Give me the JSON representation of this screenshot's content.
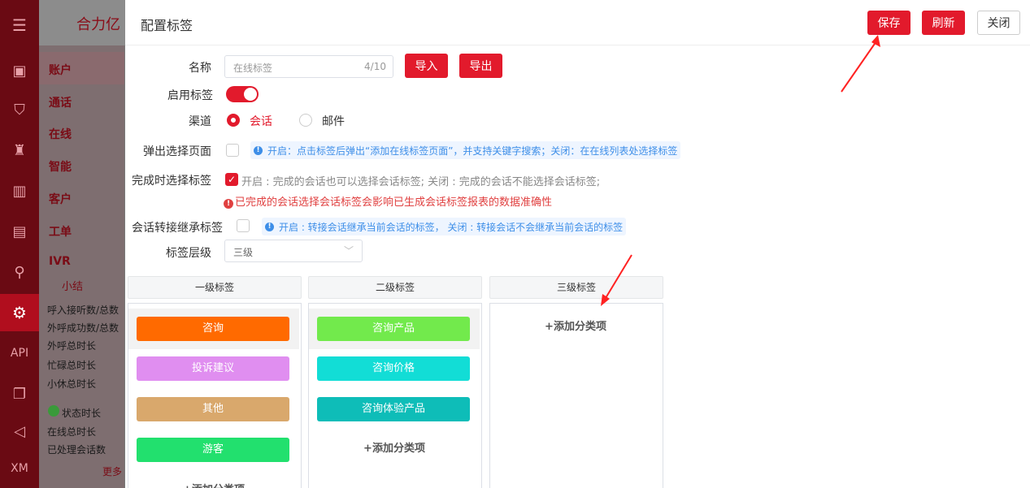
{
  "rail": {
    "items": [
      {
        "icon": "menu-icon",
        "glyph": "☰"
      },
      {
        "icon": "monitor-icon",
        "glyph": "▣"
      },
      {
        "icon": "shield-icon",
        "glyph": "⛉"
      },
      {
        "icon": "robot-icon",
        "glyph": "♜"
      },
      {
        "icon": "bar-chart-icon",
        "glyph": "▥"
      },
      {
        "icon": "chat-icon",
        "glyph": "▤"
      },
      {
        "icon": "org-tree-icon",
        "glyph": "⚲"
      },
      {
        "icon": "gear-icon",
        "glyph": "⚙"
      },
      {
        "icon": "book-icon",
        "glyph": "❐"
      },
      {
        "icon": "megaphone-icon",
        "glyph": "◁"
      }
    ],
    "api_label": "API",
    "xm_label": "XM"
  },
  "background": {
    "title": "合力亿",
    "nav": [
      "账户",
      "通话",
      "在线",
      "智能",
      "客户",
      "工单",
      "IVR"
    ],
    "sub_title": "小结",
    "stats": [
      "呼入接听数/总数",
      "外呼成功数/总数",
      "外呼总时长",
      "忙碌总时长",
      "小休总时长",
      "状态时长",
      "在线总时长",
      "已处理会话数"
    ],
    "more": "更多"
  },
  "drawer": {
    "title": "配置标签",
    "save_label": "保存",
    "refresh_label": "刷新",
    "close_label": "关闭"
  },
  "form": {
    "name_label": "名称",
    "name_placeholder": "在线标签",
    "name_count": "4/10",
    "import_label": "导入",
    "export_label": "导出",
    "enable_label": "启用标签",
    "channel_label": "渠道",
    "channel_options": [
      "会话",
      "邮件"
    ],
    "popup_label": "弹出选择页面",
    "popup_tip": "开启：点击标签后弹出“添加在线标签页面”，并支持关键字搜索；关闭：在在线列表处选择标签",
    "complete_label": "完成时选择标签",
    "complete_text": "开启 : 完成的会话也可以选择会话标签; 关闭 : 完成的会话不能选择会话标签;",
    "complete_warn": "已完成的会话选择会话标签会影响已生成会话标签报表的数据准确性",
    "transfer_label": "会话转接继承标签",
    "transfer_tip": "开启 : 转接会话继承当前会话的标签， 关闭 : 转接会话不会继承当前会话的标签",
    "level_label": "标签层级",
    "level_value": "三级"
  },
  "columns": [
    {
      "header": "一级标签",
      "tags": [
        {
          "label": "咨询",
          "color": "#ff6a00"
        },
        {
          "label": "投诉建议",
          "color": "#e08ef0"
        },
        {
          "label": "其他",
          "color": "#d9a86c"
        },
        {
          "label": "游客",
          "color": "#22e06e"
        }
      ],
      "add_label": "+添加分类项"
    },
    {
      "header": "二级标签",
      "tags": [
        {
          "label": "咨询产品",
          "color": "#72ea4c"
        },
        {
          "label": "咨询价格",
          "color": "#12ddd6"
        },
        {
          "label": "咨询体验产品",
          "color": "#0ebdb8"
        }
      ],
      "add_label": "+添加分类项"
    },
    {
      "header": "三级标签",
      "tags": [],
      "add_label": "+添加分类项"
    }
  ],
  "colors": {
    "accent": "#e21a2c",
    "info": "#3d8ee8",
    "warn": "#e04040"
  }
}
